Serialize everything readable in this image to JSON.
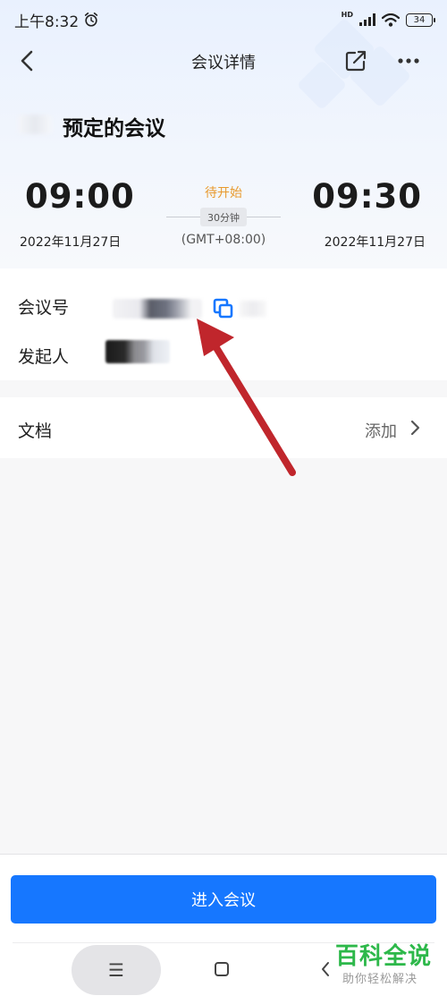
{
  "status_bar": {
    "time": "上午8:32",
    "network_label": "HD",
    "battery": "34"
  },
  "nav": {
    "title": "会议详情"
  },
  "meeting": {
    "subject": "预定的会议",
    "start_time": "09:00",
    "end_time": "09:30",
    "start_date": "2022年11月27日",
    "end_date": "2022年11月27日",
    "status": "待开始",
    "duration": "30分钟",
    "timezone": "(GMT+08:00)"
  },
  "info": {
    "meeting_id_label": "会议号",
    "host_label": "发起人"
  },
  "documents": {
    "label": "文档",
    "add_label": "添加"
  },
  "actions": {
    "enter_label": "进入会议"
  },
  "system_nav": {
    "menu_glyph": "☰"
  },
  "watermark": {
    "main": "百科全说",
    "sub": "助你轻松解决"
  },
  "colors": {
    "primary": "#1677ff",
    "status": "#e89a2e",
    "annotation_arrow": "#c0262c",
    "watermark": "#2db84a"
  }
}
